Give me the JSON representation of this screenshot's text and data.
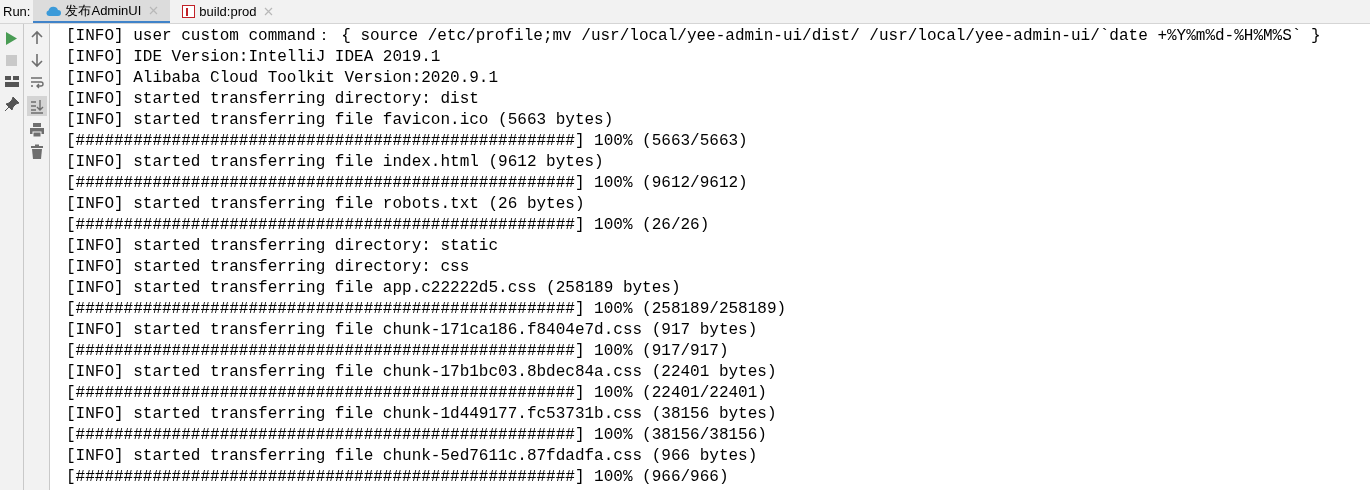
{
  "run_label": "Run:",
  "tabs": [
    {
      "kind": "cloud",
      "label": "发布AdminUI",
      "selected": true
    },
    {
      "kind": "npm",
      "label": "build:prod",
      "selected": false
    }
  ],
  "console_lines": [
    "[INFO] user custom command： { source /etc/profile;mv /usr/local/yee-admin-ui/dist/ /usr/local/yee-admin-ui/`date +%Y%m%d-%H%M%S` }",
    "[INFO] IDE Version:IntelliJ IDEA 2019.1",
    "[INFO] Alibaba Cloud Toolkit Version:2020.9.1",
    "[INFO] started transferring directory: dist",
    "[INFO] started transferring file favicon.ico (5663 bytes)",
    "[####################################################] 100% (5663/5663)",
    "[INFO] started transferring file index.html (9612 bytes)",
    "[####################################################] 100% (9612/9612)",
    "[INFO] started transferring file robots.txt (26 bytes)",
    "[####################################################] 100% (26/26)",
    "[INFO] started transferring directory: static",
    "[INFO] started transferring directory: css",
    "[INFO] started transferring file app.c22222d5.css (258189 bytes)",
    "[####################################################] 100% (258189/258189)",
    "[INFO] started transferring file chunk-171ca186.f8404e7d.css (917 bytes)",
    "[####################################################] 100% (917/917)",
    "[INFO] started transferring file chunk-17b1bc03.8bdec84a.css (22401 bytes)",
    "[####################################################] 100% (22401/22401)",
    "[INFO] started transferring file chunk-1d449177.fc53731b.css (38156 bytes)",
    "[####################################################] 100% (38156/38156)",
    "[INFO] started transferring file chunk-5ed7611c.87fdadfa.css (966 bytes)",
    "[####################################################] 100% (966/966)"
  ]
}
